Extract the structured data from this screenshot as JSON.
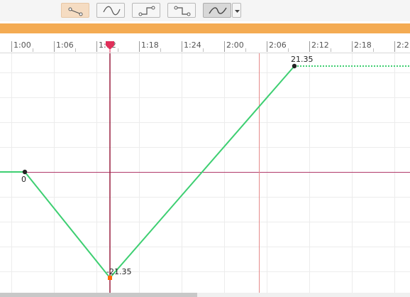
{
  "toolbar": {
    "buttons": [
      {
        "name": "linear-interp",
        "icon": "linear-interp-icon",
        "state": "active"
      },
      {
        "name": "smooth-interp",
        "icon": "smooth-curve-icon",
        "state": "normal"
      },
      {
        "name": "step-before",
        "icon": "step-up-icon",
        "state": "normal"
      },
      {
        "name": "step-after",
        "icon": "step-down-icon",
        "state": "normal"
      },
      {
        "name": "ease",
        "icon": "ease-curve-icon",
        "state": "selected"
      }
    ],
    "dropdown_icon": "triangle-down-icon"
  },
  "ruler": {
    "labels": [
      "1:00",
      "1:06",
      "1:12",
      "1:18",
      "1:24",
      "2:00",
      "2:06",
      "2:12",
      "2:18",
      "2:2"
    ],
    "playhead_label": "1:12"
  },
  "graph": {
    "keyframes": [
      {
        "time": "1:02",
        "value": 0,
        "label": "0"
      },
      {
        "time": "1:14",
        "value": -21.35,
        "label": "-21.35"
      },
      {
        "time": "2:08",
        "value": 21.35,
        "label": "21.35"
      }
    ]
  },
  "colors": {
    "curve": "#3ecf72",
    "playhead": "#e0305a",
    "axis": "#b13a6a",
    "accent_bar": "#f4ab53",
    "keyframe": "#222222",
    "selected_key": "#ff6a00"
  }
}
